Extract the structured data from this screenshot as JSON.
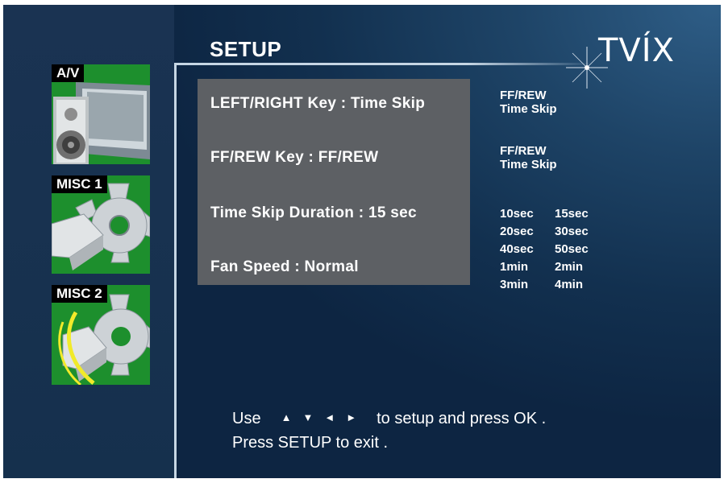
{
  "header": {
    "title": "SETUP",
    "logo": "TVÍX"
  },
  "sidebar": {
    "tiles": [
      {
        "label": "A/V",
        "icon": "speaker-tv-icon"
      },
      {
        "label": "MISC 1",
        "icon": "gear-icon"
      },
      {
        "label": "MISC 2",
        "icon": "gear-fan-icon"
      }
    ]
  },
  "settings": [
    {
      "text": "LEFT/RIGHT Key : Time Skip"
    },
    {
      "text": "FF/REW Key : FF/REW"
    },
    {
      "text": "Time Skip Duration  : 15 sec"
    },
    {
      "text": "Fan Speed : Normal"
    }
  ],
  "options": {
    "left_right_key": [
      "FF/REW",
      "Time Skip"
    ],
    "ff_rew_key": [
      "FF/REW",
      "Time Skip"
    ],
    "duration": [
      [
        "10sec",
        "15sec"
      ],
      [
        "20sec",
        "30sec"
      ],
      [
        "40sec",
        "50sec"
      ],
      [
        "1min",
        "2min"
      ],
      [
        "3min",
        "4min"
      ]
    ]
  },
  "help": {
    "line1_lead": "Use",
    "arrows": [
      "▲",
      "▼",
      "◄",
      "►"
    ],
    "line1_tail": "to setup and press OK .",
    "line2": "Press SETUP to exit ."
  },
  "colors": {
    "background": "#12304f",
    "panel": "#5d6064",
    "tile": "#1d8f2d",
    "accent_line": "#c6d6e4"
  }
}
